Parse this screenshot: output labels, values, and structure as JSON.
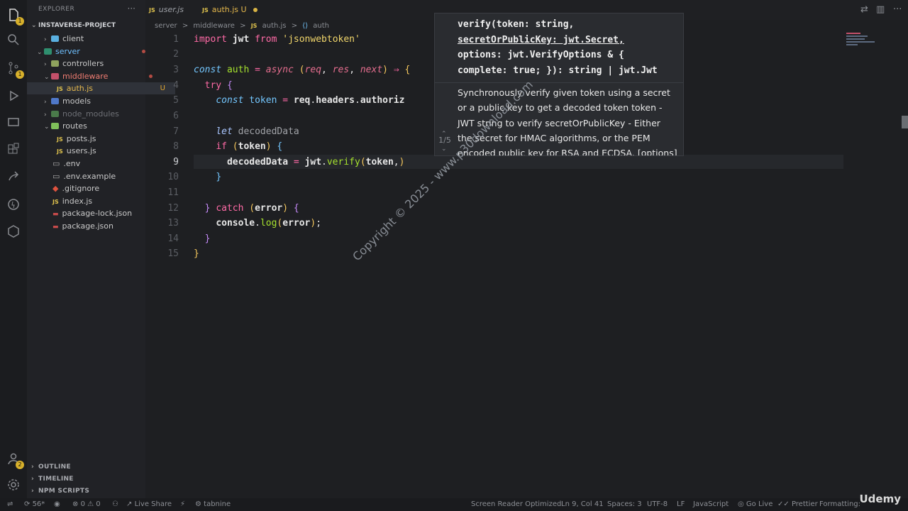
{
  "explorer": {
    "title": "EXPLORER",
    "project": "INSTAVERSE-PROJECT",
    "items": [
      {
        "label": "client",
        "type": "folder"
      },
      {
        "label": "server",
        "type": "folder"
      },
      {
        "label": "controllers",
        "type": "folder"
      },
      {
        "label": "middleware",
        "type": "folder"
      },
      {
        "label": "auth.js",
        "type": "file",
        "status": "U"
      },
      {
        "label": "models",
        "type": "folder"
      },
      {
        "label": "node_modules",
        "type": "folder"
      },
      {
        "label": "routes",
        "type": "folder"
      },
      {
        "label": "posts.js",
        "type": "file"
      },
      {
        "label": "users.js",
        "type": "file"
      },
      {
        "label": ".env",
        "type": "file"
      },
      {
        "label": ".env.example",
        "type": "file"
      },
      {
        "label": ".gitignore",
        "type": "file"
      },
      {
        "label": "index.js",
        "type": "file"
      },
      {
        "label": "package-lock.json",
        "type": "file"
      },
      {
        "label": "package.json",
        "type": "file"
      }
    ],
    "sections": [
      "OUTLINE",
      "TIMELINE",
      "NPM SCRIPTS"
    ]
  },
  "tabs": [
    {
      "label": "user.js"
    },
    {
      "label": "auth.js",
      "status": "U"
    }
  ],
  "breadcrumb": [
    "server",
    ">",
    "middleware",
    ">",
    "auth.js",
    ">",
    "auth"
  ],
  "editor": {
    "line_numbers": [
      "1",
      "2",
      "3",
      "4",
      "5",
      "6",
      "7",
      "8",
      "9",
      "10",
      "11",
      "12",
      "13",
      "14",
      "15"
    ],
    "current_line": "9"
  },
  "hover": {
    "signature_lines": [
      "verify(token: string,",
      "secretOrPublicKey: jwt.Secret,",
      "options: jwt.VerifyOptions & {",
      "complete: true; }): string | jwt.Jwt"
    ],
    "doc_lines": [
      "Synchronously verify given token using a secret",
      "or a public key to get a decoded token token -",
      "JWT string to verify secretOrPublicKey - Either",
      "the secret for HMAC algorithms, or the PEM",
      "encoded public key for RSA and ECDSA. [options]"
    ],
    "count": "1/5"
  },
  "watermark": "Copyright © 2025 - www.p30download.com",
  "status": {
    "branch_count": "56*",
    "errors": "0",
    "warnings": "0",
    "live_share": "Live Share",
    "tabnine": "tabnine",
    "screen_reader": "Screen Reader Optimized",
    "position": "Ln 9, Col 41",
    "spaces": "Spaces: 3",
    "encoding": "UTF-8",
    "eol": "LF",
    "language": "JavaScript",
    "go_live": "Go Live",
    "prettier": "Prettier",
    "formatting": "Formatting:"
  },
  "udemy": "Udemy",
  "colors": {
    "accent": "#ff6aa6",
    "badge": "#d7b02b"
  }
}
